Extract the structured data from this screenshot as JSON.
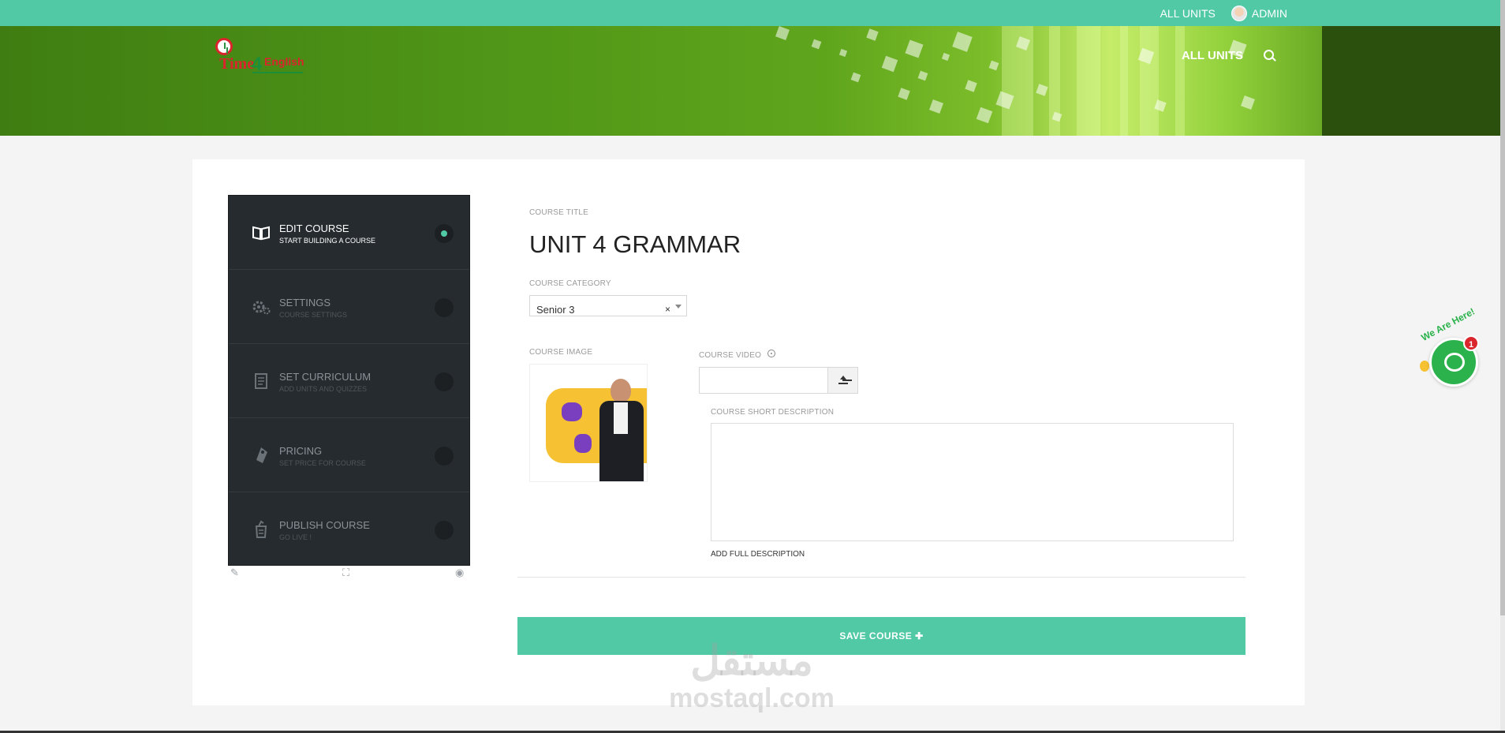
{
  "topbar": {
    "all_units": "ALL UNITS",
    "admin": "ADMIN"
  },
  "header": {
    "logo_text": "Time4English",
    "logo_time": "Time",
    "logo_four": "4",
    "logo_english": "English",
    "nav_all_units": "ALL UNITS"
  },
  "sidebar": {
    "steps": [
      {
        "title": "EDIT COURSE",
        "subtitle": "START BUILDING A COURSE",
        "icon": "book-icon"
      },
      {
        "title": "SETTINGS",
        "subtitle": "COURSE SETTINGS",
        "icon": "gears-icon"
      },
      {
        "title": "SET CURRICULUM",
        "subtitle": "ADD UNITS AND QUIZZES",
        "icon": "document-icon"
      },
      {
        "title": "PRICING",
        "subtitle": "SET PRICE FOR COURSE",
        "icon": "tag-icon"
      },
      {
        "title": "PUBLISH COURSE",
        "subtitle": "GO LIVE !",
        "icon": "publish-icon"
      }
    ]
  },
  "form": {
    "title_label": "COURSE TITLE",
    "title_value": "UNIT 4 GRAMMAR",
    "category_label": "COURSE CATEGORY",
    "category_value": "Senior 3",
    "image_label": "COURSE IMAGE",
    "video_label": "COURSE VIDEO",
    "video_value": "",
    "short_desc_label": "COURSE SHORT DESCRIPTION",
    "short_desc_value": "",
    "add_full_description": "ADD FULL DESCRIPTION",
    "save_button": "SAVE COURSE ✚"
  },
  "watermark": {
    "arabic": "مستقل",
    "latin": "mostaql.com"
  },
  "chat": {
    "label": "We Are Here!",
    "badge": "1"
  },
  "colors": {
    "accent": "#52c9a5",
    "sidebar_bg": "#262b2f",
    "chat_green": "#2bb24c",
    "badge_red": "#d9252b"
  }
}
